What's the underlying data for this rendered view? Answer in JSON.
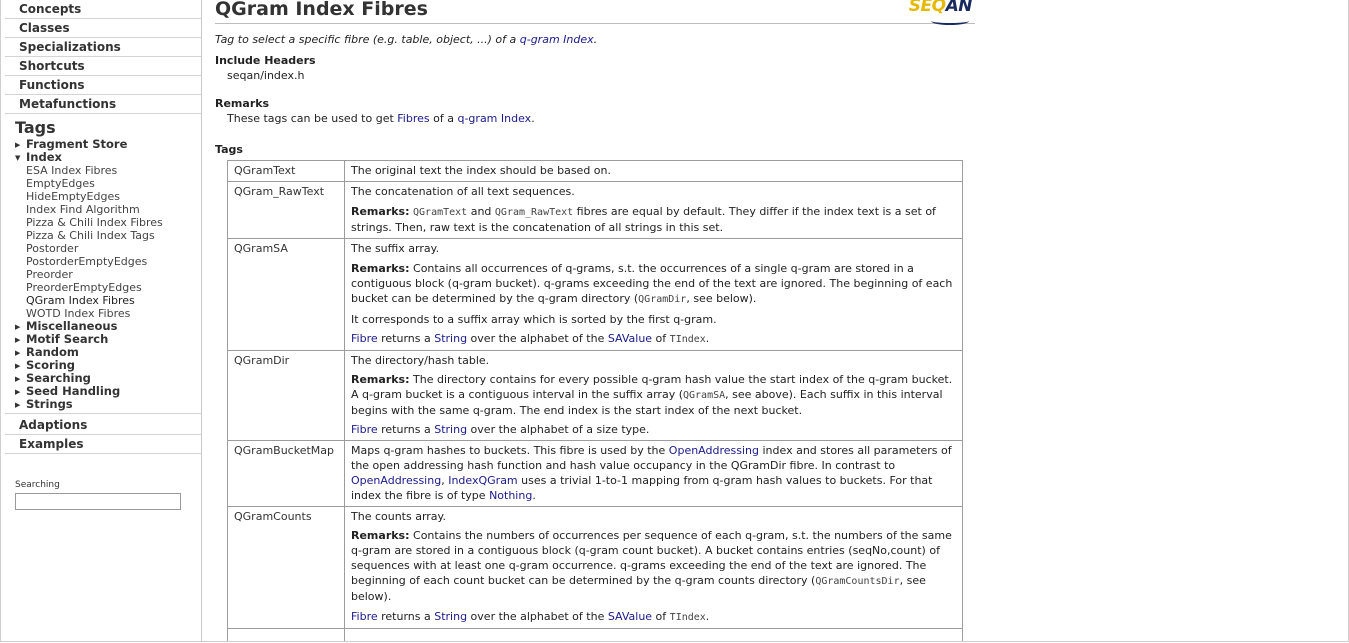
{
  "sidebar": {
    "sections_top": [
      "Concepts",
      "Classes",
      "Specializations",
      "Shortcuts",
      "Functions",
      "Metafunctions"
    ],
    "tags_heading": "Tags",
    "tags": {
      "fragment_store": "Fragment Store",
      "index": "Index",
      "index_children": [
        "ESA Index Fibres",
        "EmptyEdges",
        "HideEmptyEdges",
        "Index Find Algorithm",
        "Pizza & Chili Index Fibres",
        "Pizza & Chili Index Tags",
        "Postorder",
        "PostorderEmptyEdges",
        "Preorder",
        "PreorderEmptyEdges",
        "QGram Index Fibres",
        "WOTD Index Fibres"
      ],
      "others": [
        "Miscellaneous",
        "Motif Search",
        "Random",
        "Scoring",
        "Searching",
        "Seed Handling",
        "Strings"
      ]
    },
    "sections_bottom": [
      "Adaptions",
      "Examples"
    ],
    "search": {
      "label": "Searching",
      "value": ""
    }
  },
  "header": {
    "title": "QGram Index Fibres",
    "logo_text_a": "SEQ",
    "logo_text_b": "AN"
  },
  "main": {
    "desc_prefix": "Tag to select a specific fibre (e.g. table, object, ...) of a ",
    "desc_link": "q-gram Index",
    "desc_suffix": ".",
    "include_heading": "Include Headers",
    "include_value": "seqan/index.h",
    "remarks_heading": "Remarks",
    "remarks_a": "These tags can be used to get ",
    "remarks_link1": "Fibres",
    "remarks_b": " of a ",
    "remarks_link2": "q-gram Index",
    "remarks_c": ".",
    "tags_heading": "Tags"
  },
  "rows": {
    "text": {
      "name": "QGramText",
      "desc": "The original text the index should be based on."
    },
    "raw": {
      "name": "QGram_RawText",
      "desc": "The concatenation of all text sequences.",
      "remarks_label": "Remarks:",
      "code1": "QGramText",
      "mid1": " and ",
      "code2": "QGram_RawText",
      "rest": " fibres are equal by default. They differ if the index text is a set of strings. Then, raw text is the concatenation of all strings in this set."
    },
    "sa": {
      "name": "QGramSA",
      "desc": "The suffix array.",
      "remarks_label": "Remarks:",
      "remarks_text": " Contains all occurrences of q-grams, s.t. the occurrences of a single q-gram are stored in a contiguous block (q-gram bucket). q-grams exceeding the end of the text are ignored. The beginning of each bucket can be determined by the q-gram directory (",
      "code": "QGramDir",
      "remarks_end": ", see below).",
      "extra": "It corresponds to a suffix array which is sorted by the first q-gram.",
      "fibre": "Fibre",
      "returns": " returns a ",
      "string": "String",
      "over": " over the alphabet of the ",
      "savalue": "SAValue",
      "of": " of ",
      "tindex": "TIndex",
      "dot": "."
    },
    "dir": {
      "name": "QGramDir",
      "desc": "The directory/hash table.",
      "remarks_label": "Remarks:",
      "remarks_text": " The directory contains for every possible q-gram hash value the start index of the q-gram bucket. A q-gram bucket is a contiguous interval in the suffix array (",
      "code": "QGramSA",
      "remarks_end": ", see above). Each suffix in this interval begins with the same q-gram. The end index is the start index of the next bucket.",
      "fibre": "Fibre",
      "returns": " returns a ",
      "string": "String",
      "over": " over the alphabet of a size type."
    },
    "bucket": {
      "name": "QGramBucketMap",
      "t1": "Maps q-gram hashes to buckets. This fibre is used by the ",
      "link1": "OpenAddressing",
      "t2": " index and stores all parameters of the open addressing hash function and hash value occupancy in the QGramDir fibre. In contrast to ",
      "link2": "OpenAddressing",
      "comma": ", ",
      "link3": "IndexQGram",
      "t3": " uses a trivial 1-to-1 mapping from q-gram hash values to buckets. For that index the fibre is of type ",
      "link4": "Nothing",
      "t4": "."
    },
    "counts": {
      "name": "QGramCounts",
      "desc": "The counts array.",
      "remarks_label": "Remarks:",
      "remarks_text": " Contains the numbers of occurrences per sequence of each q-gram, s.t. the numbers of the same q-gram are stored in a contiguous block (q-gram count bucket). A bucket contains entries (seqNo,count) of sequences with at least one q-gram occurrence. q-grams exceeding the end of the text are ignored. The beginning of each count bucket can be determined by the q-gram counts directory (",
      "code": "QGramCountsDir",
      "remarks_end": ", see below).",
      "fibre": "Fibre",
      "returns": " returns a ",
      "string": "String",
      "over": " over the alphabet of the ",
      "savalue": "SAValue",
      "of": " of ",
      "tindex": "TIndex",
      "dot": "."
    }
  },
  "colors": {
    "link": "#1a1a8c",
    "logo_yellow": "#e6b800",
    "logo_navy": "#1b2a5e"
  }
}
